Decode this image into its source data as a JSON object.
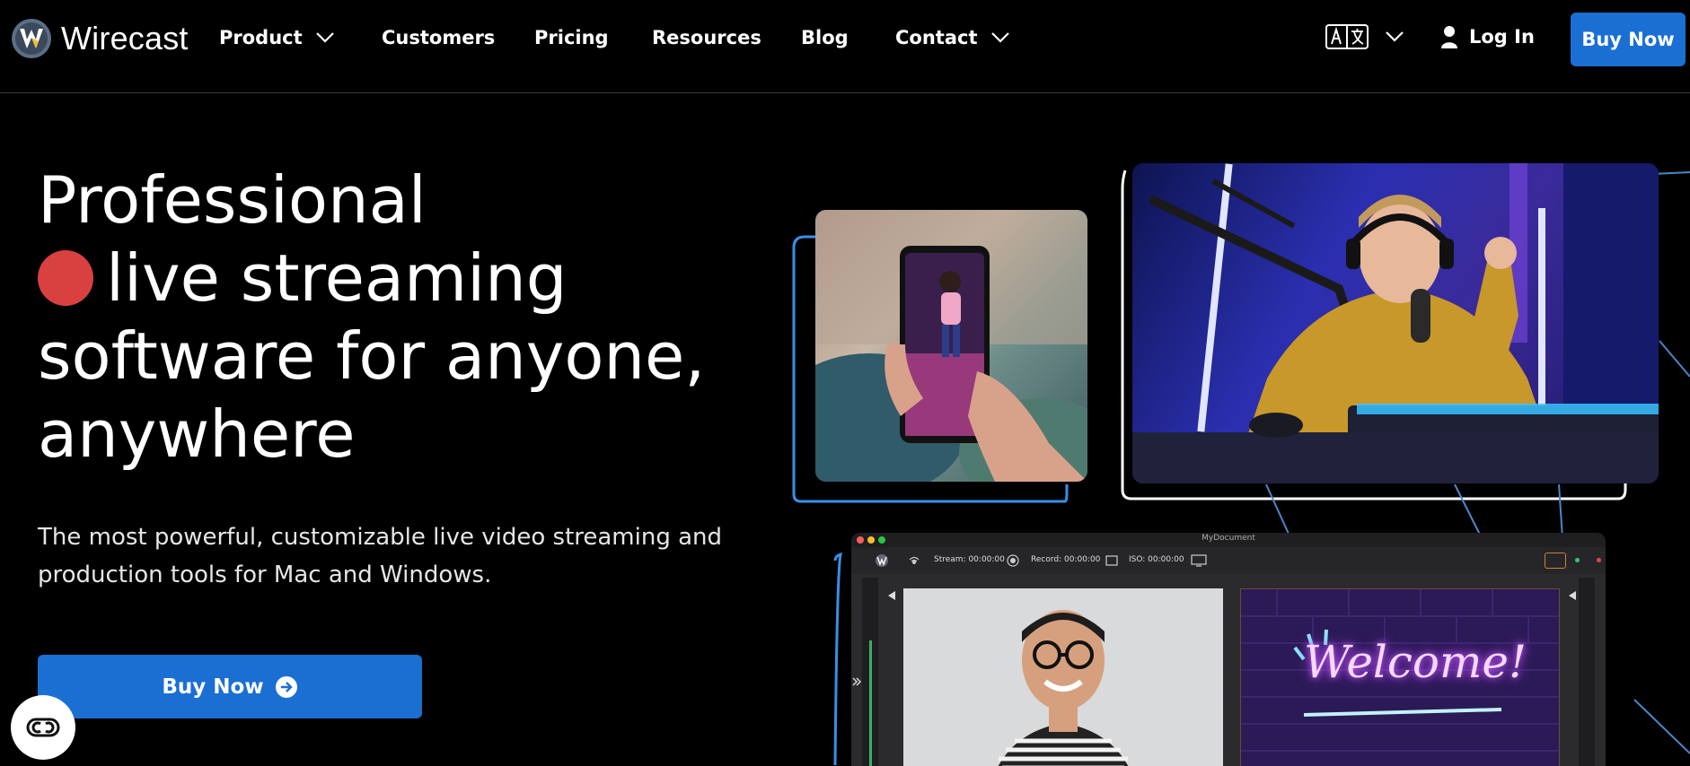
{
  "brand": {
    "name": "Wirecast"
  },
  "nav": {
    "items": [
      {
        "label": "Product",
        "has_dropdown": true
      },
      {
        "label": "Customers",
        "has_dropdown": false
      },
      {
        "label": "Pricing",
        "has_dropdown": false
      },
      {
        "label": "Resources",
        "has_dropdown": false
      },
      {
        "label": "Blog",
        "has_dropdown": false
      },
      {
        "label": "Contact",
        "has_dropdown": true
      }
    ],
    "language_icon": "language-icon",
    "login_label": "Log In",
    "buy_label": "Buy Now"
  },
  "hero": {
    "headline_1": "Professional",
    "headline_2": "live streaming",
    "headline_3": "software for anyone,",
    "headline_4": "anywhere",
    "subtitle": "The most powerful, customizable live video streaming and production tools for Mac and Windows.",
    "cta_label": "Buy Now"
  },
  "app_preview": {
    "window_title": "MyDocument",
    "stream_label": "Stream: 00:00:00",
    "record_label": "Record: 00:00:00",
    "iso_label": "ISO: 00:00:00",
    "shot_text": "Welcome!"
  },
  "colors": {
    "accent": "#1b6fd3",
    "record_dot": "#d8413f",
    "background": "#000000"
  }
}
